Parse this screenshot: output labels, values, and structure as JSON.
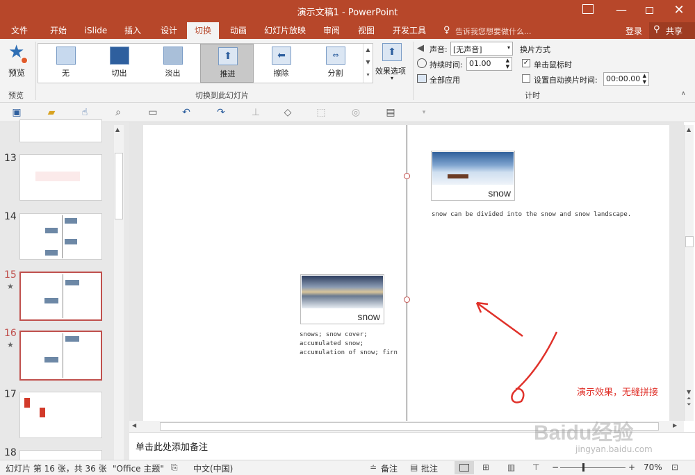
{
  "window": {
    "title": "演示文稿1 - PowerPoint"
  },
  "tabs": [
    {
      "label": "文件"
    },
    {
      "label": "开始"
    },
    {
      "label": "iSlide"
    },
    {
      "label": "插入"
    },
    {
      "label": "设计"
    },
    {
      "label": "切换"
    },
    {
      "label": "动画"
    },
    {
      "label": "幻灯片放映"
    },
    {
      "label": "审阅"
    },
    {
      "label": "视图"
    },
    {
      "label": "开发工具"
    }
  ],
  "tellme": "告诉我您想要做什么...",
  "account": {
    "login": "登录",
    "share": "共享"
  },
  "ribbon": {
    "preview": {
      "label": "预览",
      "group": "预览"
    },
    "transitions": [
      {
        "label": "无"
      },
      {
        "label": "切出"
      },
      {
        "label": "淡出"
      },
      {
        "label": "推进"
      },
      {
        "label": "擦除"
      },
      {
        "label": "分割"
      }
    ],
    "effect_options": "效果选项",
    "group_transition": "切换到此幻灯片",
    "timing": {
      "sound_label": "声音:",
      "sound_value": "[无声音]",
      "duration_label": "持续时间:",
      "duration_value": "01.00",
      "apply_all": "全部应用",
      "advance_label": "换片方式",
      "on_click": "单击鼠标时",
      "after_label": "设置自动换片时间:",
      "after_value": "00:00.00",
      "group": "计时"
    }
  },
  "slides_pane": {
    "numbers": [
      "13",
      "14",
      "15",
      "16",
      "17",
      "18"
    ],
    "star": "★"
  },
  "slide": {
    "card1_word": "snow",
    "card1_text": "snow can be divided into the snow and snow landscape.",
    "card2_word": "snow",
    "card2_text": "snows; snow cover; accumulated snow; accumulation of snow; firn",
    "annotation": "演示效果，无缝拼接"
  },
  "notes": "单击此处添加备注",
  "status": {
    "slide_info": "幻灯片 第 16 张，共 36 张",
    "theme": "\"Office 主题\"",
    "language": "中文(中国)",
    "notes_btn": "备注",
    "comments_btn": "批注",
    "zoom": "70%"
  },
  "watermark": {
    "text": "Baidu经验",
    "url": "jingyan.baidu.com"
  },
  "colors": {
    "accent": "#b7472a",
    "annotation": "#e0312a"
  }
}
